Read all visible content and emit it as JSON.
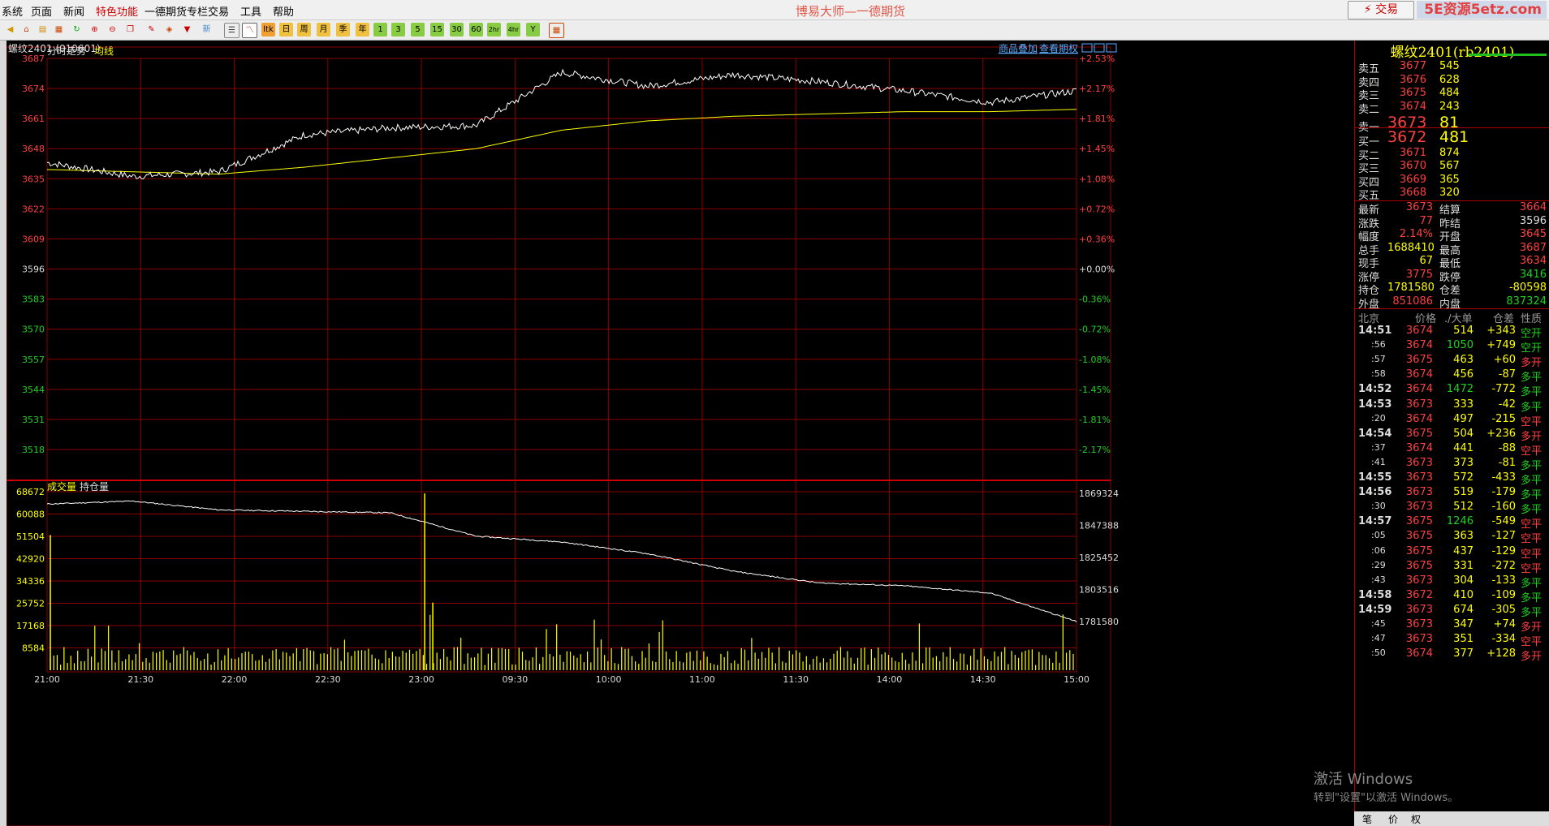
{
  "menu": [
    "系统",
    "页面",
    "新闻",
    "特色功能",
    "一德期货专栏",
    "交易",
    "工具",
    "帮助"
  ],
  "app_title": "博易大师—一德期货",
  "trade_button": "交易",
  "watermark": "5E资源5etz.com",
  "toolbar_labels": [
    "ltk",
    "日",
    "周",
    "月",
    "季",
    "年",
    "1",
    "3",
    "5",
    "15",
    "30",
    "60",
    "2hr",
    "4hr",
    "Y",
    "新"
  ],
  "chart": {
    "symbol_header": "螺纹2401 (010601)",
    "link_overlay": "商品叠加",
    "link_option": "查看期权",
    "legend_main": "分时走势",
    "legend_avg": "均线",
    "legend_volume": "成交量",
    "legend_oi": "持仓量",
    "price_ticks": [
      "3687",
      "3674",
      "3661",
      "3648",
      "3635",
      "3622",
      "3609",
      "3596",
      "3583",
      "3570",
      "3557",
      "3544",
      "3531",
      "3518"
    ],
    "pct_ticks": [
      "+2.53%",
      "+2.17%",
      "+1.81%",
      "+1.45%",
      "+1.08%",
      "+0.72%",
      "+0.36%",
      "+0.00%",
      "-0.36%",
      "-0.72%",
      "-1.08%",
      "-1.45%",
      "-1.81%",
      "-2.17%"
    ],
    "vol_ticks": [
      "68672",
      "60088",
      "51504",
      "42920",
      "34336",
      "25752",
      "17168",
      "8584"
    ],
    "oi_ticks": [
      "1869324",
      "1847388",
      "1825452",
      "1803516",
      "1781580"
    ],
    "time_ticks": [
      "21:00",
      "21:30",
      "22:00",
      "22:30",
      "23:00",
      "09:30",
      "10:00",
      "11:00",
      "11:30",
      "14:00",
      "14:30",
      "15:00"
    ],
    "colors": {
      "up": "#ff4040",
      "down": "#20d020",
      "grid": "#8b0000",
      "price_line": "#ffffff",
      "avg_line": "#ffff00",
      "volume": "#ffff00"
    }
  },
  "chart_data": {
    "type": "line",
    "title": "螺纹2401",
    "ylim": [
      3518,
      3687
    ],
    "reference": 3596,
    "x": [
      "21:00",
      "21:30",
      "22:00",
      "22:30",
      "23:00",
      "09:30",
      "10:00",
      "11:00",
      "11:30",
      "14:00",
      "14:30",
      "15:00"
    ],
    "series": [
      {
        "name": "分时走势",
        "values": [
          3642,
          3636,
          3638,
          3654,
          3657,
          3658,
          3681,
          3675,
          3680,
          3677,
          3673,
          3668,
          3673
        ]
      },
      {
        "name": "均线",
        "values": [
          3639,
          3638,
          3637,
          3640,
          3644,
          3648,
          3656,
          3660,
          3662,
          3663,
          3664,
          3664,
          3665
        ]
      },
      {
        "name": "持仓量",
        "values": [
          1862000,
          1864000,
          1858000,
          1857000,
          1856000,
          1840000,
          1836000,
          1828000,
          1816000,
          1808000,
          1806000,
          1801000,
          1781580
        ]
      }
    ],
    "volume_ylim": [
      0,
      68672
    ],
    "volume_spikes": [
      {
        "time": "21:00",
        "value": 52000
      },
      {
        "time": "23:00",
        "value": 68000
      },
      {
        "time": "23:00",
        "value": 26000
      }
    ]
  },
  "quote": {
    "title": "螺纹2401(rb2401)",
    "asks": [
      {
        "label": "卖五",
        "price": "3677",
        "vol": "545"
      },
      {
        "label": "卖四",
        "price": "3676",
        "vol": "628"
      },
      {
        "label": "卖三",
        "price": "3675",
        "vol": "484"
      },
      {
        "label": "卖二",
        "price": "3674",
        "vol": "243"
      },
      {
        "label": "卖一",
        "price": "3673",
        "vol": "81"
      }
    ],
    "bids": [
      {
        "label": "买一",
        "price": "3672",
        "vol": "481"
      },
      {
        "label": "买二",
        "price": "3671",
        "vol": "874"
      },
      {
        "label": "买三",
        "price": "3670",
        "vol": "567"
      },
      {
        "label": "买四",
        "price": "3669",
        "vol": "365"
      },
      {
        "label": "买五",
        "price": "3668",
        "vol": "320"
      }
    ],
    "stats": [
      {
        "l1": "最新",
        "v1": "3673",
        "c1": "up",
        "l2": "结算",
        "v2": "3664",
        "c2": "up"
      },
      {
        "l1": "涨跌",
        "v1": "77",
        "c1": "up",
        "l2": "昨结",
        "v2": "3596",
        "c2": "white"
      },
      {
        "l1": "幅度",
        "v1": "2.14%",
        "c1": "up",
        "l2": "开盘",
        "v2": "3645",
        "c2": "up"
      },
      {
        "l1": "总手",
        "v1": "1688410",
        "c1": "yellow",
        "l2": "最高",
        "v2": "3687",
        "c2": "up"
      },
      {
        "l1": "现手",
        "v1": "67",
        "c1": "yellow",
        "l2": "最低",
        "v2": "3634",
        "c2": "up"
      },
      {
        "l1": "涨停",
        "v1": "3775",
        "c1": "up",
        "l2": "跌停",
        "v2": "3416",
        "c2": "down"
      },
      {
        "l1": "持仓",
        "v1": "1781580",
        "c1": "yellow",
        "l2": "仓差",
        "v2": "-80598",
        "c2": "yellow"
      },
      {
        "l1": "外盘",
        "v1": "851086",
        "c1": "up",
        "l2": "内盘",
        "v2": "837324",
        "c2": "down"
      }
    ],
    "tick_header": [
      "北京",
      "价格",
      "./大单",
      "仓差",
      "性质"
    ],
    "ticks": [
      {
        "t": "14:51",
        "p": "3674",
        "v": "514",
        "d": "+343",
        "n": "空开",
        "pc": "up",
        "nc": "down"
      },
      {
        "t": ":56",
        "p": "3674",
        "v": "1050",
        "d": "+749",
        "n": "空开",
        "pc": "up",
        "nc": "down"
      },
      {
        "t": ":57",
        "p": "3675",
        "v": "463",
        "d": "+60",
        "n": "多开",
        "pc": "up",
        "nc": "up"
      },
      {
        "t": ":58",
        "p": "3674",
        "v": "456",
        "d": "-87",
        "n": "多平",
        "pc": "up",
        "nc": "down"
      },
      {
        "t": "14:52",
        "p": "3674",
        "v": "1472",
        "d": "-772",
        "n": "多平",
        "pc": "up",
        "nc": "down"
      },
      {
        "t": "14:53",
        "p": "3673",
        "v": "333",
        "d": "-42",
        "n": "多平",
        "pc": "up",
        "nc": "down"
      },
      {
        "t": ":20",
        "p": "3674",
        "v": "497",
        "d": "-215",
        "n": "空平",
        "pc": "up",
        "nc": "up"
      },
      {
        "t": "14:54",
        "p": "3675",
        "v": "504",
        "d": "+236",
        "n": "多开",
        "pc": "up",
        "nc": "up"
      },
      {
        "t": ":37",
        "p": "3674",
        "v": "441",
        "d": "-88",
        "n": "空平",
        "pc": "up",
        "nc": "up"
      },
      {
        "t": ":41",
        "p": "3673",
        "v": "373",
        "d": "-81",
        "n": "多平",
        "pc": "up",
        "nc": "down"
      },
      {
        "t": "14:55",
        "p": "3673",
        "v": "572",
        "d": "-433",
        "n": "多平",
        "pc": "up",
        "nc": "down"
      },
      {
        "t": "14:56",
        "p": "3673",
        "v": "519",
        "d": "-179",
        "n": "多平",
        "pc": "up",
        "nc": "down"
      },
      {
        "t": ":30",
        "p": "3673",
        "v": "512",
        "d": "-160",
        "n": "多平",
        "pc": "up",
        "nc": "down"
      },
      {
        "t": "14:57",
        "p": "3675",
        "v": "1246",
        "d": "-549",
        "n": "空平",
        "pc": "up",
        "nc": "up"
      },
      {
        "t": ":05",
        "p": "3675",
        "v": "363",
        "d": "-127",
        "n": "空平",
        "pc": "up",
        "nc": "up"
      },
      {
        "t": ":06",
        "p": "3675",
        "v": "437",
        "d": "-129",
        "n": "空平",
        "pc": "up",
        "nc": "up"
      },
      {
        "t": ":29",
        "p": "3675",
        "v": "331",
        "d": "-272",
        "n": "空平",
        "pc": "up",
        "nc": "up"
      },
      {
        "t": ":43",
        "p": "3673",
        "v": "304",
        "d": "-133",
        "n": "多平",
        "pc": "up",
        "nc": "down"
      },
      {
        "t": "14:58",
        "p": "3672",
        "v": "410",
        "d": "-109",
        "n": "多平",
        "pc": "up",
        "nc": "down"
      },
      {
        "t": "14:59",
        "p": "3673",
        "v": "674",
        "d": "-305",
        "n": "多平",
        "pc": "up",
        "nc": "down"
      },
      {
        "t": ":45",
        "p": "3673",
        "v": "347",
        "d": "+74",
        "n": "多开",
        "pc": "up",
        "nc": "up"
      },
      {
        "t": ":47",
        "p": "3673",
        "v": "351",
        "d": "-334",
        "n": "空平",
        "pc": "up",
        "nc": "up"
      },
      {
        "t": ":50",
        "p": "3674",
        "v": "377",
        "d": "+128",
        "n": "多开",
        "pc": "up",
        "nc": "up"
      }
    ],
    "bottom_tabs": [
      "笔",
      "价",
      "权"
    ]
  },
  "activation": {
    "line1": "激活 Windows",
    "line2": "转到\"设置\"以激活 Windows。"
  }
}
